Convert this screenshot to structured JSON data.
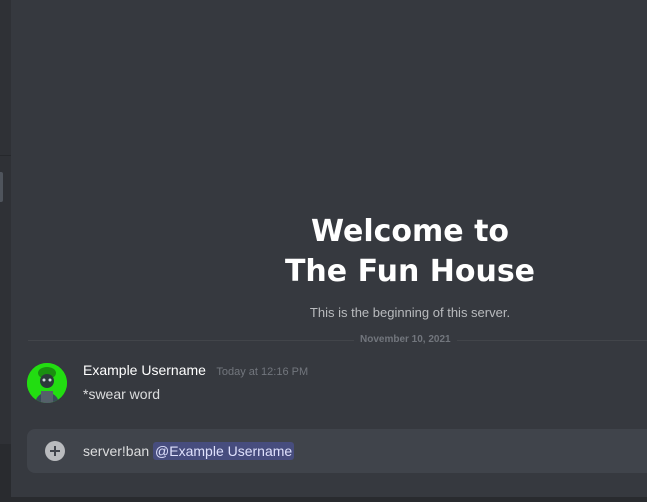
{
  "welcome": {
    "title_line1": "Welcome to",
    "title_line2": "The Fun House",
    "subtitle": "This is the beginning of this server."
  },
  "chat": {
    "date_divider": "November 10, 2021",
    "messages": [
      {
        "username": "Example Username",
        "timestamp": "Today at 12:16 PM",
        "content": "*swear word",
        "avatar_icon": "green-avatar-icon"
      }
    ]
  },
  "composer": {
    "text": "server!ban",
    "mention": "@Example Username",
    "attach_icon": "plus-circle-icon"
  },
  "colors": {
    "background": "#36393f",
    "sidebar": "#2f3136",
    "composer": "#40444b",
    "mention_bg": "#474d7e",
    "mention_text": "#dee0fc",
    "avatar_green": "#22dd11"
  }
}
